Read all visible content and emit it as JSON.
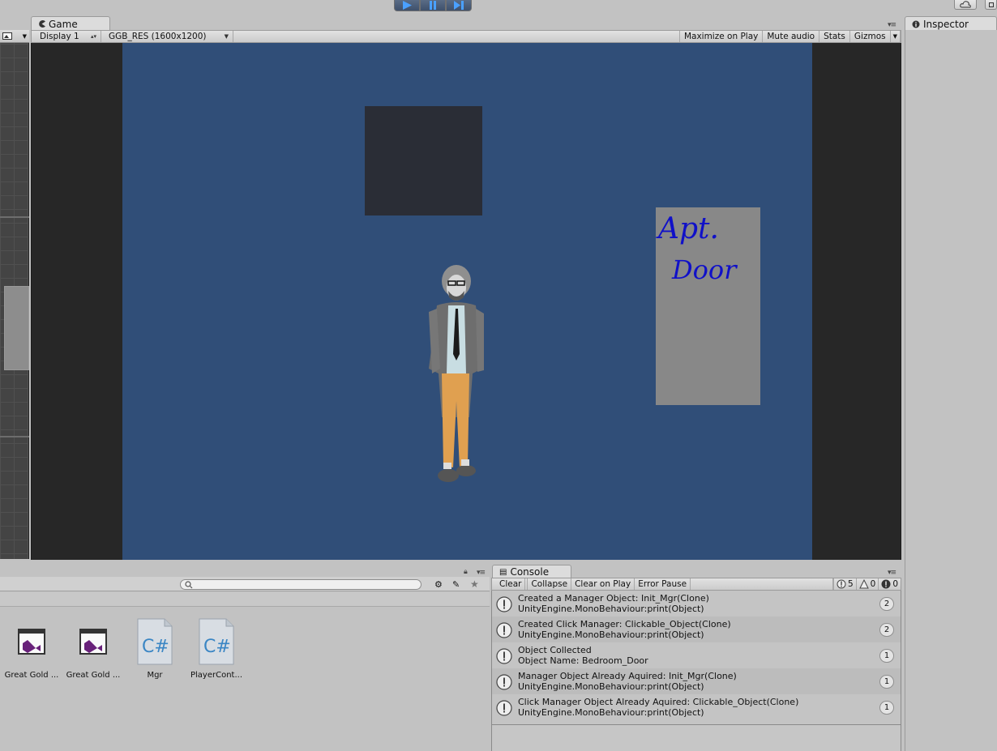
{
  "game": {
    "tab_label": "Game",
    "display": "Display 1",
    "resolution": "GGB_RES (1600x1200)",
    "maximize": "Maximize on Play",
    "mute": "Mute audio",
    "stats": "Stats",
    "gizmos": "Gizmos",
    "canvas_color": "#304e78"
  },
  "scene": {
    "door_text_line1": "Apt.",
    "door_text_line2": "Door"
  },
  "project": {
    "assets": [
      {
        "name": "Great Gold ...",
        "icon": "visual-studio-solution-icon"
      },
      {
        "name": "Great Gold ...",
        "icon": "visual-studio-solution-icon"
      },
      {
        "name": "Mgr",
        "icon": "csharp-script-icon"
      },
      {
        "name": "PlayerCont...",
        "icon": "csharp-script-icon"
      }
    ]
  },
  "console": {
    "tab_label": "Console",
    "clear": "Clear",
    "collapse": "Collapse",
    "clear_on_play": "Clear on Play",
    "error_pause": "Error Pause",
    "log_count": "5",
    "warning_count": "0",
    "error_count": "0",
    "entries": [
      {
        "line1": "Created a Manager Object: Init_Mgr(Clone)",
        "line2": "UnityEngine.MonoBehaviour:print(Object)",
        "count": "2"
      },
      {
        "line1": "Created Click Manager: Clickable_Object(Clone)",
        "line2": "UnityEngine.MonoBehaviour:print(Object)",
        "count": "2"
      },
      {
        "line1": "Object Collected",
        "line2": "Object Name: Bedroom_Door",
        "count": "1"
      },
      {
        "line1": "Manager Object Already Aquired: Init_Mgr(Clone)",
        "line2": "UnityEngine.MonoBehaviour:print(Object)",
        "count": "1"
      },
      {
        "line1": "Click Manager Object Already Aquired: Clickable_Object(Clone)",
        "line2": "UnityEngine.MonoBehaviour:print(Object)",
        "count": "1"
      }
    ]
  },
  "inspector": {
    "tab_label": "Inspector"
  }
}
